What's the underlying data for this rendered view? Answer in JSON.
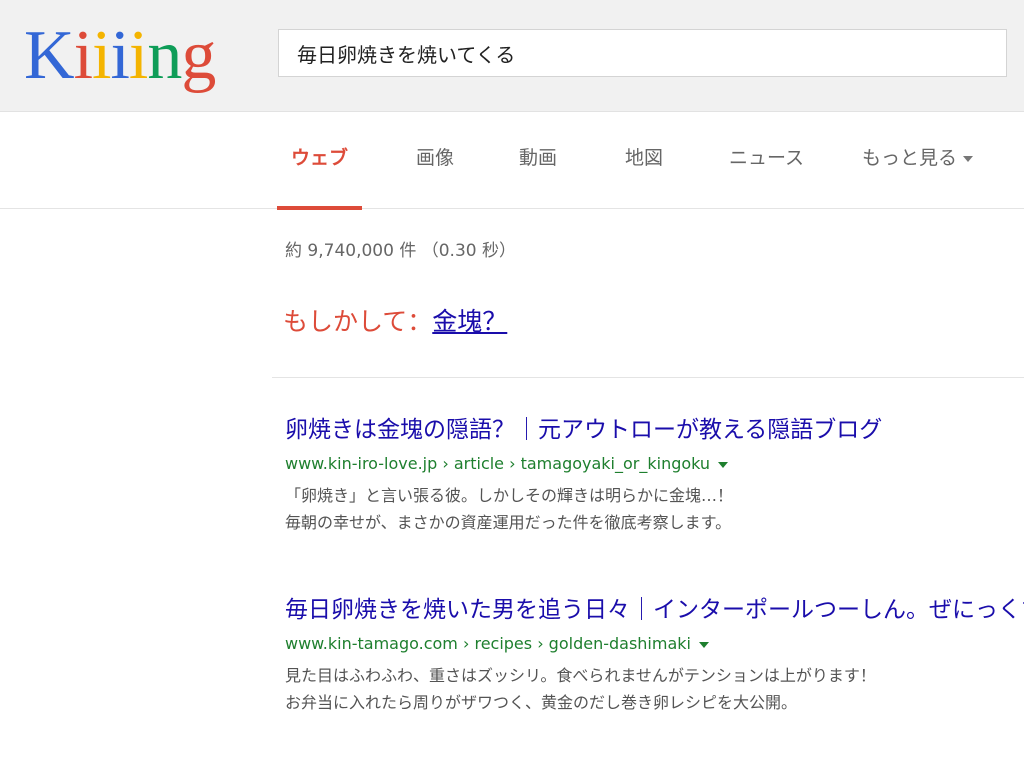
{
  "logo": {
    "letters": [
      {
        "char": "K",
        "color": "#3367d6"
      },
      {
        "char": "i",
        "color": "#dd4b39"
      },
      {
        "char": "i",
        "color": "#f4b400"
      },
      {
        "char": "i",
        "color": "#3367d6"
      },
      {
        "char": "i",
        "color": "#f4b400"
      },
      {
        "char": "n",
        "color": "#0f9d58"
      },
      {
        "char": "g",
        "color": "#dd4b39"
      }
    ]
  },
  "search": {
    "query": "毎日卵焼きを焼いてくる"
  },
  "nav": {
    "tabs": [
      {
        "label": "ウェブ",
        "active": true
      },
      {
        "label": "画像",
        "active": false
      },
      {
        "label": "動画",
        "active": false
      },
      {
        "label": "地図",
        "active": false
      },
      {
        "label": "ニュース",
        "active": false
      },
      {
        "label": "もっと見る",
        "active": false,
        "has_dropdown": true
      }
    ]
  },
  "stats": {
    "text": "約 9,740,000 件 （0.30 秒）"
  },
  "suggestion": {
    "prompt": "もしかして：",
    "term": "金塊？"
  },
  "results": [
    {
      "title": "卵焼きは金塊の隠語？｜元アウトローが教える隠語ブログ",
      "url": "www.kin-iro-love.jp › article › tamagoyaki_or_kingoku",
      "snippet": [
        "「卵焼き」と言い張る彼。しかしその輝きは明らかに金塊…！",
        "毎朝の幸せが、まさかの資産運用だった件を徹底考察します。"
      ]
    },
    {
      "title": "毎日卵焼きを焼いた男を追う日々｜インターポールつーしん。ぜにっくす",
      "url": "www.kin-tamago.com › recipes › golden-dashimaki",
      "snippet": [
        "見た目はふわふわ、重さはズッシリ。食べられませんがテンションは上がります！",
        "お弁当に入れたら周りがザワつく、黄金のだし巻き卵レシピを大公開。"
      ]
    }
  ],
  "colors": {
    "accent": "#dd4b39",
    "link": "#1a0dab",
    "url": "#1e7f2e",
    "snippet": "#545454",
    "header_bg": "#f1f1f1"
  }
}
